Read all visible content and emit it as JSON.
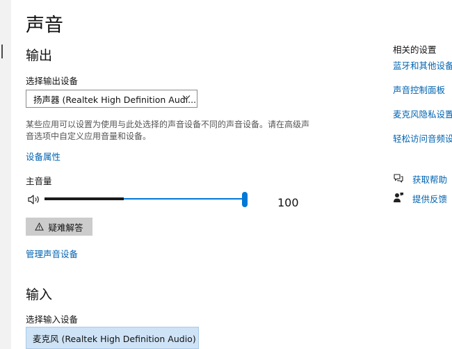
{
  "page": {
    "title": "声音"
  },
  "output": {
    "heading": "输出",
    "device_label": "选择输出设备",
    "device_value": "扬声器 (Realtek High Definition Audi...",
    "description": "某些应用可以设置为使用与此处选择的声音设备不同的声音设备。请在高级声音选项中自定义应用音量和设备。",
    "properties_link": "设备属性",
    "volume_label": "主音量",
    "volume_value": "100",
    "volume_level_fraction": 1.0,
    "peak_meter_fraction": 0.4,
    "troubleshoot_label": "疑难解答",
    "manage_link": "管理声音设备"
  },
  "input": {
    "heading": "输入",
    "device_label": "选择输入设备",
    "device_value": "麦克风 (Realtek High Definition Audio)"
  },
  "sidebar": {
    "related_heading": "相关的设置",
    "links": [
      {
        "label": "蓝牙和其他设备"
      },
      {
        "label": "声音控制面板"
      },
      {
        "label": "麦克风隐私设置"
      },
      {
        "label": "轻松访问音频设"
      }
    ],
    "help_label": "获取帮助",
    "feedback_label": "提供反馈"
  },
  "icons": {
    "volume": "speaker-icon",
    "chevron": "chevron-down-icon",
    "warning": "warning-icon",
    "help": "help-chat-icon",
    "feedback": "feedback-icon"
  },
  "colors": {
    "accent": "#0078d7",
    "link": "#0063b1",
    "button_bg": "#cccccc",
    "selected_bg": "#cfe3f6"
  }
}
